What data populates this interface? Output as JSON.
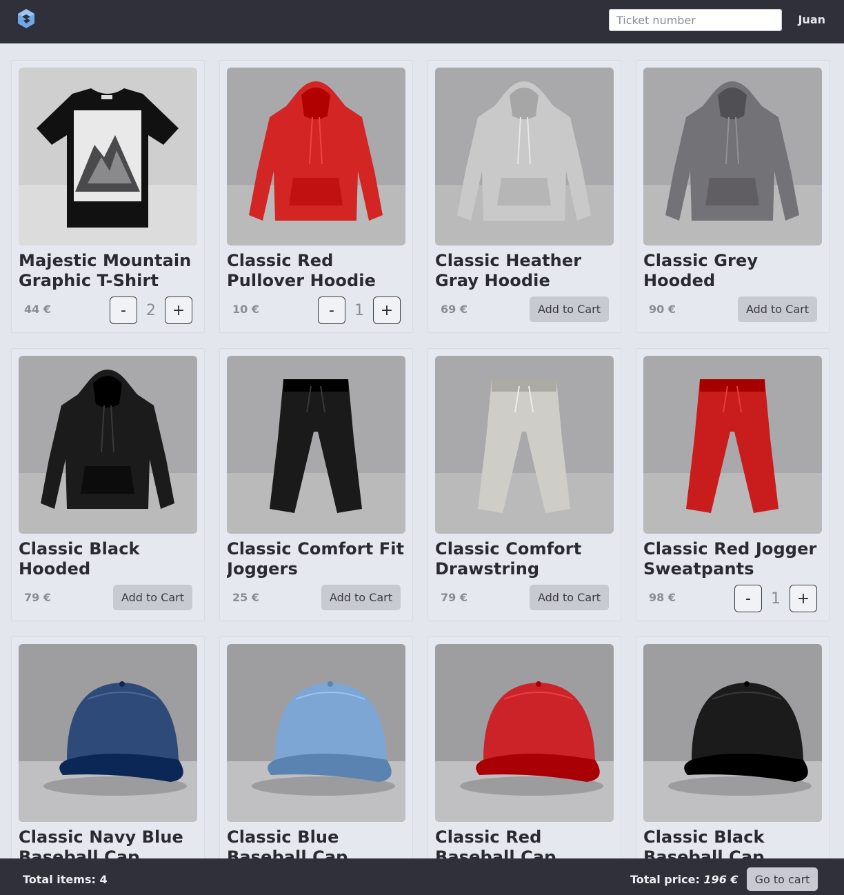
{
  "header": {
    "search_placeholder": "Ticket number",
    "user_name": "Juan"
  },
  "products": [
    {
      "title": "Majestic Mountain Graphic T-Shirt",
      "price": "44 €",
      "qty": "2",
      "in_cart": true,
      "image": "tshirt",
      "color": "#111111"
    },
    {
      "title": "Classic Red Pullover Hoodie",
      "price": "10 €",
      "qty": "1",
      "in_cart": true,
      "image": "hoodie",
      "color": "#d42525"
    },
    {
      "title": "Classic Heather Gray Hoodie",
      "price": "69 €",
      "in_cart": false,
      "image": "hoodie",
      "color": "#c9c9c9"
    },
    {
      "title": "Classic Grey Hooded Sweatshirt",
      "price": "90 €",
      "in_cart": false,
      "image": "hoodie",
      "color": "#737276"
    },
    {
      "title": "Classic Black Hooded Sweatshirt",
      "price": "79 €",
      "in_cart": false,
      "image": "hoodie",
      "color": "#1b1b1b"
    },
    {
      "title": "Classic Comfort Fit Joggers",
      "price": "25 €",
      "in_cart": false,
      "image": "joggers",
      "color": "#1a1a1a"
    },
    {
      "title": "Classic Comfort Drawstring Joggers",
      "price": "79 €",
      "in_cart": false,
      "image": "joggers",
      "color": "#cfcdc8"
    },
    {
      "title": "Classic Red Jogger Sweatpants",
      "price": "98 €",
      "qty": "1",
      "in_cart": true,
      "image": "joggers",
      "color": "#c91d1d"
    },
    {
      "title": "Classic Navy Blue Baseball Cap",
      "price": "",
      "in_cart": false,
      "image": "cap",
      "color": "#2e4a78"
    },
    {
      "title": "Classic Blue Baseball Cap",
      "price": "",
      "in_cart": false,
      "image": "cap",
      "color": "#7ea6d4"
    },
    {
      "title": "Classic Red Baseball Cap",
      "price": "",
      "in_cart": false,
      "image": "cap",
      "color": "#cc2329"
    },
    {
      "title": "Classic Black Baseball Cap",
      "price": "",
      "in_cart": false,
      "image": "cap",
      "color": "#1b1b1b"
    }
  ],
  "labels": {
    "add_to_cart": "Add to Cart",
    "minus": "-",
    "plus": "+"
  },
  "footer": {
    "total_items_label": "Total items:",
    "total_items": "4",
    "total_price_label": "Total price:",
    "total_price": "196 €",
    "go_to_cart": "Go to cart"
  },
  "colors": {
    "topbar": "#2f3039",
    "background": "#e4e6ee",
    "logo": "#6ea8e8"
  }
}
